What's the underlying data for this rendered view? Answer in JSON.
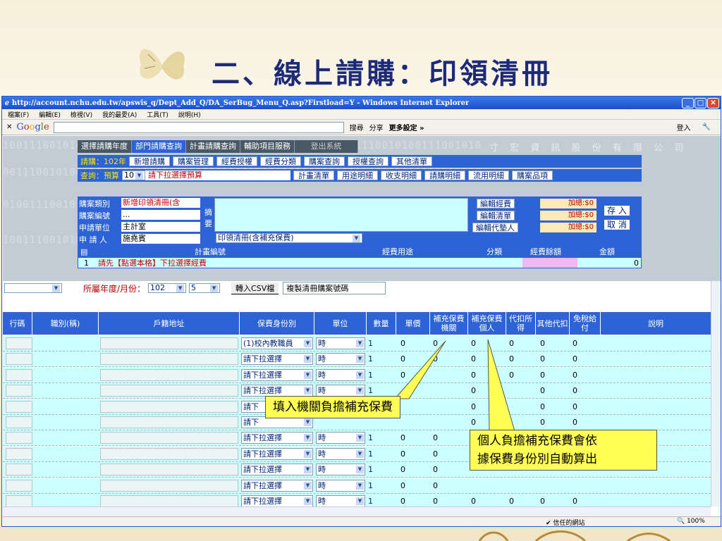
{
  "slide": {
    "title": "二、線上請購：印領清冊"
  },
  "browser": {
    "title": "http://account.nchu.edu.tw/apswis_q/Dept_Add_Q/DA_SerBug_Menu_Q.asp?Firstload=Y - Windows Internet Explorer",
    "menu": [
      "檔案(F)",
      "編輯(E)",
      "檢視(V)",
      "我的最愛(A)",
      "工具(T)",
      "說明(H)"
    ],
    "google": {
      "search": "搜尋",
      "share": "分享",
      "more": "更多設定 »",
      "login": "登入"
    }
  },
  "site": {
    "company": "寸 宏 資 訊 股 份 有 限 公 司",
    "top_nav": [
      "選擇請購年度",
      "部門請購查詢",
      "計畫請購查詢",
      "輔助項目服務",
      "登出系統"
    ],
    "row2_label": "請購：102年",
    "row2_buttons": [
      "新增請購",
      "購案管理",
      "經費授權",
      "經費分類",
      "購案查詢",
      "授權查詢",
      "其他清單"
    ],
    "row3_label": "查詢：預算",
    "row3_select": "10",
    "row3_hint": "請下拉選擇預算",
    "row3_buttons": [
      "計畫清單",
      "用途明細",
      "收支明細",
      "請購明細",
      "流用明細",
      "購案品項"
    ],
    "form": {
      "labels": [
        "購案類別",
        "購案編號",
        "申請單位",
        "申 請 人"
      ],
      "values": [
        "新增印領清冊(含",
        "...",
        "主計室",
        "施堯賓"
      ],
      "summary_label": [
        "摘",
        "要"
      ],
      "category_select": "印領清冊(含補充保費)",
      "side_buttons": [
        "編輯經費",
        "編輯清單",
        "編輯代墊人"
      ],
      "totals": [
        "加總:$0",
        "加總:$0",
        "加總:$0"
      ],
      "save": "存 入",
      "cancel": "取 消"
    },
    "item_header": [
      "計畫編號",
      "經費用途",
      "分類",
      "經費餘額",
      "金額"
    ],
    "item_row": {
      "no": "1",
      "hint": "請先【點選本格】下拉選擇經費",
      "amount": "0"
    }
  },
  "filter": {
    "label": "所屬年度/月份：",
    "year": "102",
    "month": "5",
    "csv": "轉入CSV檔",
    "copy": "複製清冊購案號碼"
  },
  "grid": {
    "headers": [
      "行碼",
      "職別(稱)",
      "戶籍地址",
      "保費身份別",
      "單位",
      "數量",
      "單價",
      "補充保費機關",
      "補充保費個人",
      "代扣所得",
      "其他代扣",
      "免稅給付",
      "說明"
    ],
    "rows": [
      {
        "status": "(1)校內教職員",
        "unit": "時",
        "qty": "1",
        "price": "0",
        "org": "0",
        "personal": "0",
        "tax": "0",
        "other": "0",
        "free": "0"
      },
      {
        "status": "請下拉選擇",
        "unit": "時",
        "qty": "1",
        "price": "0",
        "org": "0",
        "personal": "0",
        "tax": "0",
        "other": "0",
        "free": "0"
      },
      {
        "status": "請下拉選擇",
        "unit": "時",
        "qty": "1",
        "price": "0",
        "org": "",
        "personal": "0",
        "tax": "0",
        "other": "0",
        "free": "0"
      },
      {
        "status": "請下拉選擇",
        "unit": "時",
        "qty": "1",
        "price": "",
        "org": "",
        "personal": "0",
        "tax": "",
        "other": "0",
        "free": "0"
      },
      {
        "status": "請下",
        "unit": "",
        "qty": "",
        "price": "",
        "org": "",
        "personal": "0",
        "tax": "",
        "other": "0",
        "free": "0"
      },
      {
        "status": "請下",
        "unit": "",
        "qty": "",
        "price": "",
        "org": "",
        "personal": "0",
        "tax": "",
        "other": "0",
        "free": "0"
      },
      {
        "status": "請下拉選擇",
        "unit": "時",
        "qty": "1",
        "price": "0",
        "org": "0",
        "personal": "",
        "tax": "",
        "other": "",
        "free": ""
      },
      {
        "status": "請下拉選擇",
        "unit": "時",
        "qty": "1",
        "price": "0",
        "org": "0",
        "personal": "",
        "tax": "",
        "other": "",
        "free": ""
      },
      {
        "status": "請下拉選擇",
        "unit": "時",
        "qty": "1",
        "price": "0",
        "org": "0",
        "personal": "",
        "tax": "",
        "other": "",
        "free": ""
      },
      {
        "status": "請下拉選擇",
        "unit": "時",
        "qty": "1",
        "price": "0",
        "org": "0",
        "personal": "",
        "tax": "",
        "other": "",
        "free": ""
      },
      {
        "status": "請下拉選擇",
        "unit": "時",
        "qty": "1",
        "price": "0",
        "org": "0",
        "personal": "0",
        "tax": "0",
        "other": "0",
        "free": "0"
      }
    ]
  },
  "status": {
    "trusted": "信任的網站",
    "zoom": "100%"
  },
  "callouts": {
    "org": "填入機關負擔補充保費",
    "personal_line1": "個人負擔補充保費會依",
    "personal_line2": "據保費身份別自動算出"
  }
}
